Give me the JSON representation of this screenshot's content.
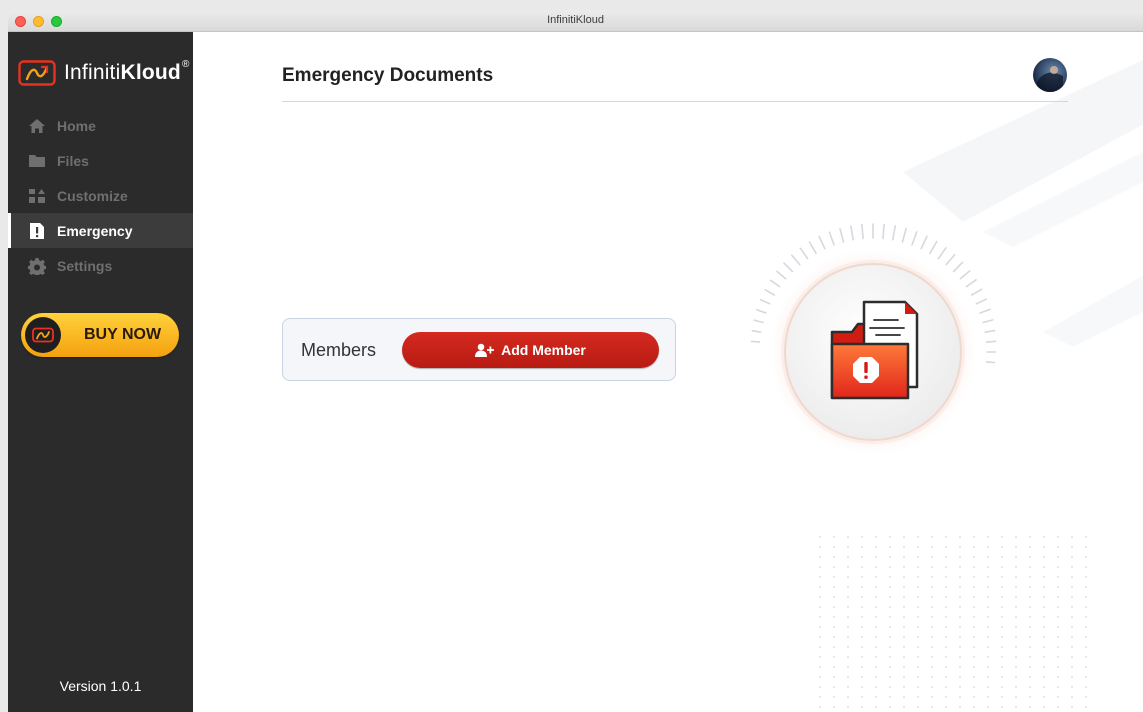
{
  "window": {
    "title": "InfinitiKloud"
  },
  "brand": {
    "name_light": "Infiniti",
    "name_bold": "Kloud",
    "registered": "®"
  },
  "sidebar": {
    "items": [
      {
        "label": "Home",
        "icon": "home-icon",
        "active": false
      },
      {
        "label": "Files",
        "icon": "folder-icon",
        "active": false
      },
      {
        "label": "Customize",
        "icon": "customize-icon",
        "active": false
      },
      {
        "label": "Emergency",
        "icon": "emergency-icon",
        "active": true
      },
      {
        "label": "Settings",
        "icon": "gear-icon",
        "active": false
      }
    ],
    "buy_label": "BUY NOW",
    "version": "Version 1.0.1"
  },
  "main": {
    "title": "Emergency Documents",
    "members_label": "Members",
    "add_member_label": "Add Member"
  },
  "colors": {
    "sidebar_bg": "#2b2b2b",
    "accent_red": "#c4211a",
    "buy_yellow": "#f9b81f"
  }
}
